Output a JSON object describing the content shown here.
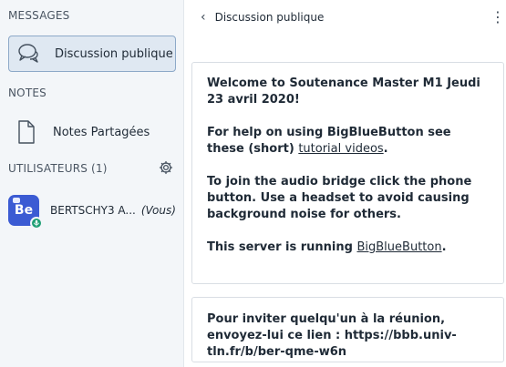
{
  "sidebar": {
    "sections": {
      "messages": "MESSAGES",
      "notes": "NOTES",
      "users": "UTILISATEURS (1)"
    },
    "chat": {
      "label": "Discussion publique"
    },
    "notes": {
      "label": "Notes Partagées"
    },
    "user": {
      "avatar_initials": "Be",
      "name": "BERTSCHY3 A...",
      "you": "(Vous)"
    }
  },
  "chat_header": {
    "title": "Discussion publique"
  },
  "welcome": {
    "line1_prefix": "Welcome to ",
    "line1_bold": "Soutenance Master M1 Jeudi 23 avril 2020!",
    "help_prefix": "For help on using BigBlueButton see these (short) ",
    "help_link": "tutorial videos",
    "help_suffix": ".",
    "audio": "To join the audio bridge click the phone button. Use a headset to avoid causing background noise for others.",
    "server_prefix": "This server is running ",
    "server_link": "BigBlueButton",
    "server_suffix": "."
  },
  "invite": {
    "text": "Pour inviter quelqu'un à la réunion, envoyez-lui ce lien : https://bbb.univ-tln.fr/b/ber-qme-w6n"
  },
  "colors": {
    "sidebar_bg": "#f3f6f9",
    "active_item_bg": "#dfe8f2",
    "active_item_border": "#8da9c8",
    "avatar_bg": "#3b5bd3",
    "presence_green": "#1d9e74"
  }
}
